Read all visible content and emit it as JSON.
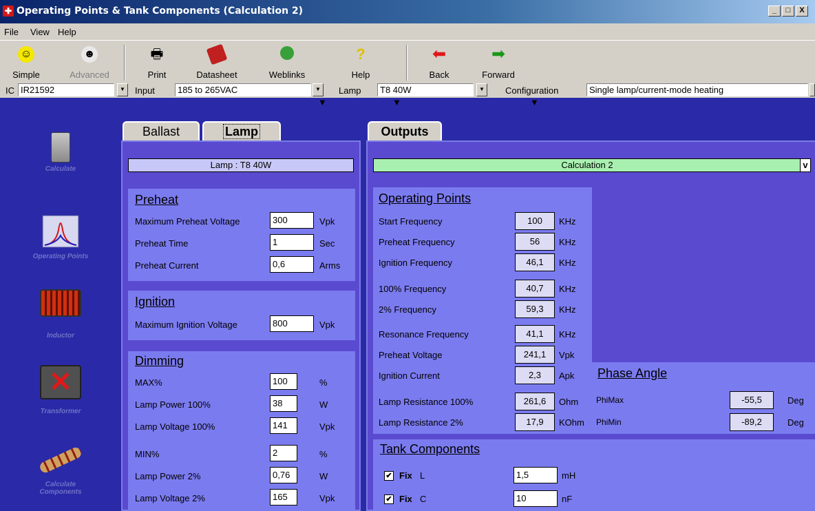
{
  "window": {
    "title": "Operating Points & Tank Components (Calculation 2)",
    "controls": [
      "_",
      "□",
      "X"
    ]
  },
  "menu": [
    "File",
    "View",
    "Help"
  ],
  "toolbar": {
    "simple": "Simple",
    "advanced": "Advanced",
    "print": "Print",
    "datasheet": "Datasheet",
    "weblinks": "Weblinks",
    "help": "Help",
    "back": "Back",
    "forward": "Forward"
  },
  "selectors": {
    "ic_label": "IC",
    "ic_value": "IR21592",
    "input_label": "Input",
    "input_value": "185 to 265VAC",
    "lamp_label": "Lamp",
    "lamp_value": "T8 40W",
    "config_label": "Configuration",
    "config_value": "Single lamp/current-mode heating"
  },
  "sidebar": [
    {
      "label": "Calculate"
    },
    {
      "label": "Operating Points"
    },
    {
      "label": "Inductor"
    },
    {
      "label": "Transformer"
    },
    {
      "label": "Calculate Components"
    }
  ],
  "left_panel": {
    "tabs": [
      "Ballast",
      "Lamp"
    ],
    "active_tab": "Lamp",
    "header": "Lamp : T8 40W",
    "preheat": {
      "title": "Preheat",
      "rows": [
        {
          "label": "Maximum Preheat Voltage",
          "value": "300",
          "unit": "Vpk"
        },
        {
          "label": "Preheat Time",
          "value": "1",
          "unit": "Sec"
        },
        {
          "label": "Preheat Current",
          "value": "0,6",
          "unit": "Arms"
        }
      ]
    },
    "ignition": {
      "title": "Ignition",
      "rows": [
        {
          "label": "Maximum Ignition Voltage",
          "value": "800",
          "unit": "Vpk"
        }
      ]
    },
    "dimming": {
      "title": "Dimming",
      "rows": [
        {
          "label": "MAX%",
          "value": "100",
          "unit": "%"
        },
        {
          "label": "Lamp Power 100%",
          "value": "38",
          "unit": "W"
        },
        {
          "label": "Lamp Voltage 100%",
          "value": "141",
          "unit": "Vpk"
        },
        {
          "label": "MIN%",
          "value": "2",
          "unit": "%"
        },
        {
          "label": "Lamp Power 2%",
          "value": "0,76",
          "unit": "W"
        },
        {
          "label": "Lamp Voltage 2%",
          "value": "165",
          "unit": "Vpk"
        }
      ]
    }
  },
  "right_panel": {
    "tab": "Outputs",
    "header": "Calculation 2",
    "header_btn": "v",
    "operating_points": {
      "title": "Operating Points",
      "rows": [
        {
          "label": "Start Frequency",
          "value": "100",
          "unit": "KHz"
        },
        {
          "label": "Preheat Frequency",
          "value": "56",
          "unit": "KHz"
        },
        {
          "label": "Ignition Frequency",
          "value": "46,1",
          "unit": "KHz"
        },
        {
          "label": "100% Frequency",
          "value": "40,7",
          "unit": "KHz"
        },
        {
          "label": "2% Frequency",
          "value": "59,3",
          "unit": "KHz"
        },
        {
          "label": "Resonance Frequency",
          "value": "41,1",
          "unit": "KHz"
        },
        {
          "label": "Preheat Voltage",
          "value": "241,1",
          "unit": "Vpk"
        },
        {
          "label": "Ignition Current",
          "value": "2,3",
          "unit": "Apk"
        },
        {
          "label": "Lamp Resistance 100%",
          "value": "261,6",
          "unit": "Ohm"
        },
        {
          "label": "Lamp Resistance 2%",
          "value": "17,9",
          "unit": "KOhm"
        }
      ]
    },
    "phase_angle": {
      "title": "Phase Angle",
      "rows": [
        {
          "label": "PhiMax",
          "value": "-55,5",
          "unit": "Deg"
        },
        {
          "label": "PhiMin",
          "value": "-89,2",
          "unit": "Deg"
        }
      ]
    },
    "tank": {
      "title": "Tank Components",
      "rows": [
        {
          "fix": "Fix",
          "name": "L",
          "value": "1,5",
          "unit": "mH",
          "checked": true
        },
        {
          "fix": "Fix",
          "name": "C",
          "value": "10",
          "unit": "nF",
          "checked": true
        }
      ]
    }
  }
}
